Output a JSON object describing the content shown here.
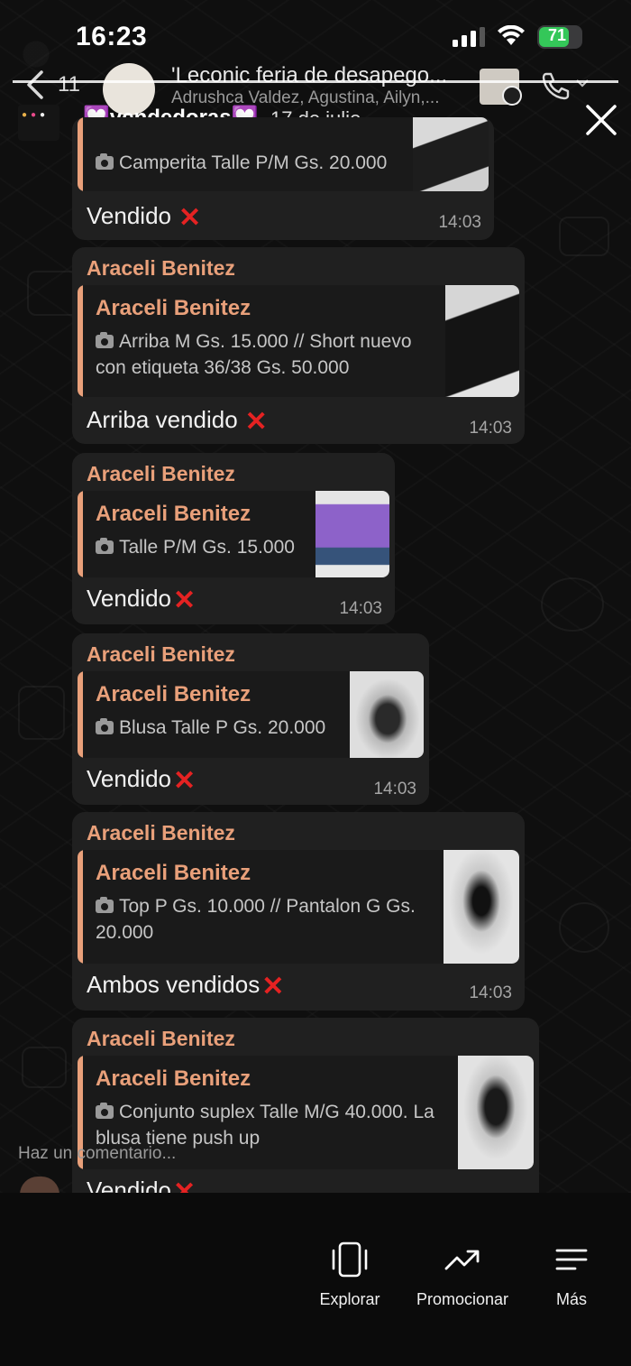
{
  "status_bar": {
    "time": "16:23",
    "battery": "71"
  },
  "chat_header": {
    "back_count": "11",
    "title": "'Leconic feria de desapego...",
    "members": "Adrushca Valdez, Agustina, Ailyn,..."
  },
  "status_overlay": {
    "title": "💟vendedoras💟",
    "date": "17 de julio"
  },
  "messages": [
    {
      "quote_text": "Camperita Talle P/M Gs. 20.000",
      "text": "Vendido",
      "time": "14:03"
    },
    {
      "sender": "Araceli Benitez",
      "quote_name": "Araceli Benitez",
      "quote_line1": "Arriba M Gs. 15.000 // Short nuevo",
      "quote_line2": "con etiqueta 36/38 Gs. 50.000",
      "text": "Arriba vendido",
      "time": "14:03"
    },
    {
      "sender": "Araceli Benitez",
      "quote_name": "Araceli Benitez",
      "quote_line1": "Talle P/M Gs. 15.000",
      "text": "Vendido",
      "time": "14:03"
    },
    {
      "sender": "Araceli Benitez",
      "quote_name": "Araceli Benitez",
      "quote_line1": "Blusa Talle P Gs. 20.000",
      "text": "Vendido",
      "time": "14:03"
    },
    {
      "sender": "Araceli Benitez",
      "quote_name": "Araceli Benitez",
      "quote_line1": "Top P Gs. 10.000 // Pantalon G Gs.",
      "quote_line2": "20.000",
      "text": "Ambos vendidos",
      "time": "14:03"
    },
    {
      "sender": "Araceli Benitez",
      "quote_name": "Araceli Benitez",
      "quote_line1": "Conjunto suplex Talle M/G 40.000. La",
      "quote_line2": "blusa tiene push up",
      "text": "Vendido"
    }
  ],
  "comment": {
    "placeholder": "Haz un comentario..."
  },
  "bottom_bar": {
    "explore": "Explorar",
    "promote": "Promocionar",
    "more": "Más"
  },
  "colors": {
    "sender_accent": "#e9a07a",
    "bubble_bg": "#202020",
    "battery_green": "#34c759",
    "cross_red": "#e52222"
  },
  "icons": [
    "back-icon",
    "call-icon",
    "close-icon",
    "camera-icon",
    "explore-icon",
    "promote-icon",
    "more-icon"
  ]
}
